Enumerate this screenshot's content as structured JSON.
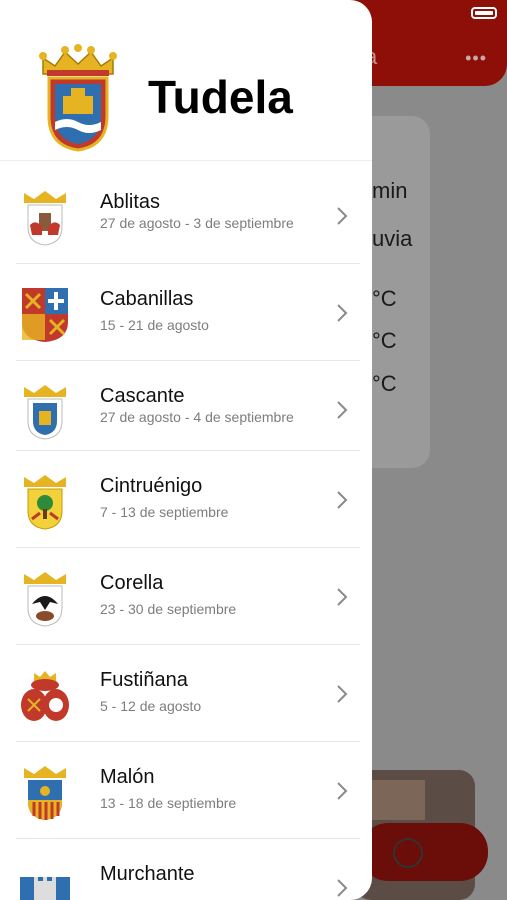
{
  "drawer": {
    "title": "Tudela"
  },
  "towns": [
    {
      "name": "Ablitas",
      "date": "27 de agosto - 3 de septiembre"
    },
    {
      "name": "Cabanillas",
      "date": "15 - 21 de agosto"
    },
    {
      "name": "Cascante",
      "date": "27 de agosto - 4 de septiembre"
    },
    {
      "name": "Cintruénigo",
      "date": "7 - 13 de septiembre"
    },
    {
      "name": "Corella",
      "date": " 23 - 30 de septiembre"
    },
    {
      "name": "Fustiñana",
      "date": "5 - 12 de agosto"
    },
    {
      "name": "Malón",
      "date": "13 - 18 de septiembre"
    },
    {
      "name": "Murchante",
      "date": ""
    }
  ],
  "background": {
    "header_fragment": "a",
    "menu_icon": "more-dots-icon",
    "weather_lines": [
      "min",
      "uvia",
      "°C",
      "°C",
      "°C"
    ]
  },
  "colors": {
    "header_red": "#8e0e08",
    "drawer_bg": "#ffffff"
  }
}
